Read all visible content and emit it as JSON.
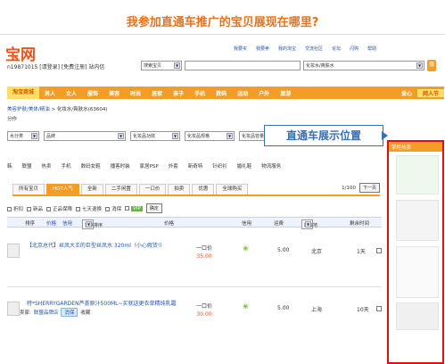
{
  "heading": "我参加直通车推广的宝贝展现在哪里?",
  "logo_text": "宝网",
  "user_line": "n19871015 [请登录] [免费注册] 站内信",
  "top_links": [
    "我要买",
    "我要卖",
    "我的淘宝",
    "交流社区",
    "论坛",
    "闪购",
    "帮助"
  ],
  "search": {
    "scope": "搜索宝贝",
    "query": "",
    "category": "化妆水/爽肤水",
    "go_label": "搜"
  },
  "nav": {
    "first": "淘宝商城",
    "items": [
      "男人",
      "女人",
      "服饰",
      "美容",
      "时尚",
      "居家",
      "亲子",
      "手机",
      "数码",
      "运动",
      "户外",
      "旅游",
      "游戏",
      "收藏"
    ],
    "right_items": [
      "爱心",
      "网人节"
    ]
  },
  "breadcrumb": {
    "parent": "美容护肤/美体/精油",
    "sep": ">",
    "current": "化妆水/爽肤水",
    "count": "(63604)"
  },
  "side_label": "分作",
  "filters": [
    "水分类",
    "品牌",
    "化妆品功效",
    "化妆品规格",
    "化妆品容量"
  ],
  "confirm_label": "确定",
  "categories": [
    "韩",
    "联盟",
    "热卖",
    "手机",
    "数码女鞋",
    "播客时装",
    "家居PSP",
    "外套",
    "新奇特",
    "针织衫",
    "婚礼鞋",
    "物流服务"
  ],
  "tabs": [
    "所有宝贝",
    "HOT人气",
    "全新",
    "二手闲置",
    "一口价",
    "拍卖",
    "优惠",
    "全球购买"
  ],
  "pager": {
    "page": "1/100",
    "next": "下一页"
  },
  "options": [
    "折扣",
    "新品",
    "正品保障",
    "七天退换",
    "消保",
    "VIP"
  ],
  "options_confirm": "确定",
  "columns": {
    "sort": "排序",
    "by": "价格",
    "default": "默认排序",
    "price": "价格",
    "rate": "信用",
    "fee": "运费",
    "loc": "所在地",
    "time": "剩余时间"
  },
  "items": [
    {
      "title": "【北京总代】丝凤大王的巨型丝凤水 320ml（小心假货!）",
      "price_label": "一口价",
      "price": "35.00",
      "fee": "5.00",
      "loc": "北京",
      "time": "1天"
    },
    {
      "title": "特*SHERRYGARDEN芦荟原汁500ML~买就送更衣草精纯乳霜",
      "price_label": "一口价",
      "price": "30.00",
      "fee": "5.00",
      "loc": "上海",
      "time": "10天"
    }
  ],
  "seller": {
    "label": "卖家:",
    "name": "联盟品牌店",
    "badge": "消保",
    "fav": "收藏"
  },
  "sidebar": {
    "title": "掌柜热卖"
  },
  "callout": "直通车展示位置"
}
